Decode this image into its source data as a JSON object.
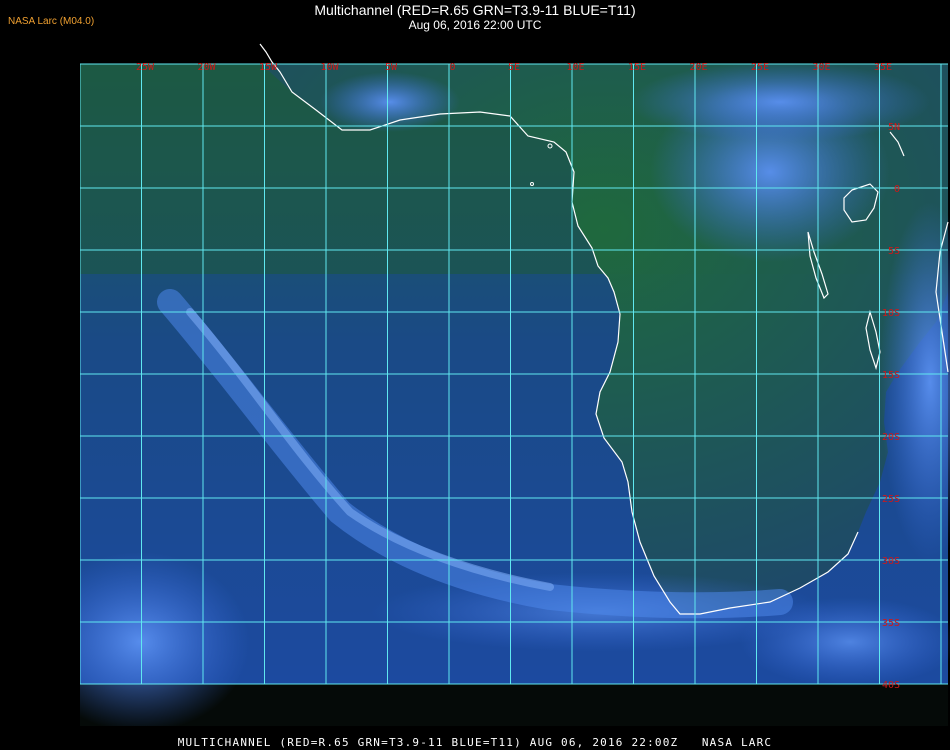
{
  "header": {
    "brand": "NASA Larc (M04.0)",
    "title": "Multichannel (RED=R.65 GRN=T3.9-11 BLUE=T11)",
    "subtitle": "Aug 06, 2016 22:00 UTC"
  },
  "footer": {
    "caption": "MULTICHANNEL (RED=R.65 GRN=T3.9-11 BLUE=T11) AUG 06, 2016 22:00Z   NASA LARC"
  },
  "map": {
    "region": "Southern Africa and South Atlantic",
    "colors": {
      "ocean": "#1a4a88",
      "land": "#1e5a3a",
      "cloud": "#3a78e8",
      "grid": "#60e8f0",
      "coast": "#ffffff",
      "tick_label": "#d01818"
    },
    "lon_labels": [
      "25W",
      "20W",
      "15W",
      "10W",
      "5W",
      "0",
      "5E",
      "10E",
      "15E",
      "20E",
      "25E",
      "30E",
      "35E"
    ],
    "lat_labels": [
      "5N",
      "0",
      "5S",
      "10S",
      "15S",
      "20S",
      "25S",
      "30S",
      "35S",
      "40S"
    ]
  }
}
